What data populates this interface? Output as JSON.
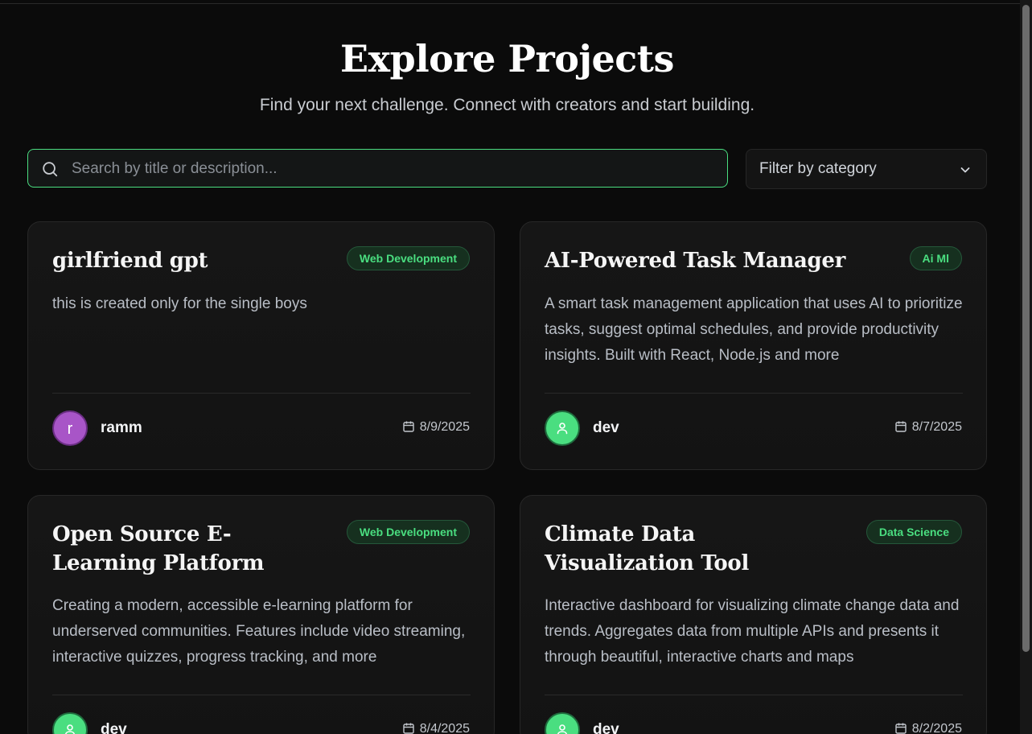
{
  "header": {
    "title": "Explore Projects",
    "subtitle": "Find your next challenge. Connect with creators and start building."
  },
  "search": {
    "placeholder": "Search by title or description...",
    "value": "",
    "icon": "search-icon"
  },
  "filter": {
    "label": "Filter by category",
    "icon": "chevron-down-icon"
  },
  "colors": {
    "accent": "#4ade80",
    "background": "#0b0b0b",
    "card": "#151515",
    "avatar_purple": "#a855c7"
  },
  "projects": [
    {
      "title": "girlfriend gpt",
      "category": "Web Development",
      "description": "this is created only for the single boys",
      "author": "ramm",
      "avatar_letter": "r",
      "date": "8/9/2025"
    },
    {
      "title": "AI-Powered Task Manager",
      "category": "Ai Ml",
      "description": "A smart task management application that uses AI to prioritize tasks, suggest optimal schedules, and provide productivity insights. Built with React, Node.js and more",
      "author": "dev",
      "avatar_letter": "",
      "date": "8/7/2025"
    },
    {
      "title": "Open Source E-Learning Platform",
      "category": "Web Development",
      "description": "Creating a modern, accessible e-learning platform for underserved communities. Features include video streaming, interactive quizzes, progress tracking, and more",
      "author": "dev",
      "avatar_letter": "",
      "date": "8/4/2025"
    },
    {
      "title": "Climate Data Visualization Tool",
      "category": "Data Science",
      "description": "Interactive dashboard for visualizing climate change data and trends. Aggregates data from multiple APIs and presents it through beautiful, interactive charts and maps",
      "author": "dev",
      "avatar_letter": "",
      "date": "8/2/2025"
    }
  ]
}
